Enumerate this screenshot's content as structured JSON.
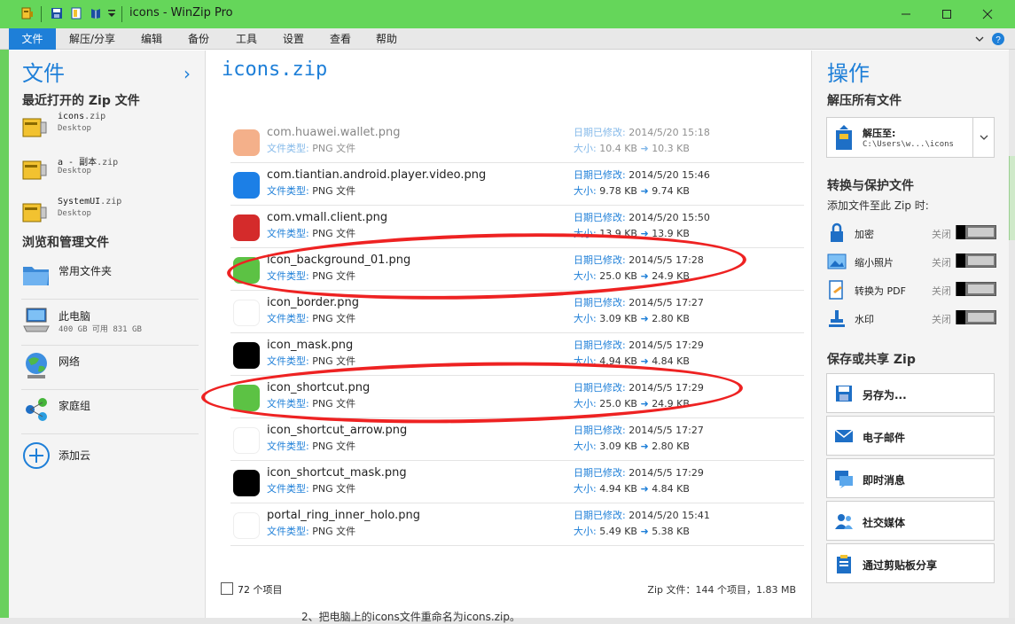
{
  "window": {
    "title": "icons - WinZip Pro",
    "title_bar_color": "#65d65a",
    "accent_color": "#1e7fd8",
    "controls": [
      "minimize-icon",
      "maximize-icon",
      "close-icon"
    ]
  },
  "menu": {
    "items": [
      "文件",
      "解压/分享",
      "编辑",
      "备份",
      "工具",
      "设置",
      "查看",
      "帮助"
    ]
  },
  "left": {
    "title": "文件",
    "recent_heading": "最近打开的 Zip 文件",
    "recent": [
      {
        "name": "icons",
        "ext": ".zip",
        "location": "Desktop"
      },
      {
        "name": "a - 副本",
        "ext": ".zip",
        "location": "Desktop"
      },
      {
        "name": "SystemUI",
        "ext": ".zip",
        "location": "Desktop"
      }
    ],
    "browse_heading": "浏览和管理文件",
    "browse": [
      {
        "label": "常用文件夹",
        "sub": "",
        "icon": "folder-icon"
      },
      {
        "label": "此电脑",
        "sub": "400 GB 可用 831 GB",
        "icon": "computer-icon"
      },
      {
        "label": "网络",
        "sub": "",
        "icon": "network-globe-icon"
      },
      {
        "label": "家庭组",
        "sub": "",
        "icon": "homegroup-icon"
      },
      {
        "label": "添加云",
        "sub": "",
        "icon": "add-cloud-icon"
      }
    ]
  },
  "main": {
    "zip_name": "icons.zip",
    "type_key": "文件类型:",
    "mod_key": "日期已修改:",
    "size_key": "大小:",
    "files": [
      {
        "name": "com.huawei.wallet.png",
        "type": "PNG 文件",
        "modified": "2014/5/20 15:18",
        "size": "10.4 KB",
        "packed": "10.3 KB",
        "thumb": "#f4b08a",
        "faded": true
      },
      {
        "name": "com.tiantian.android.player.video.png",
        "type": "PNG 文件",
        "modified": "2014/5/20 15:46",
        "size": "9.78 KB",
        "packed": "9.74 KB",
        "thumb": "#1c7fe6",
        "faded": false
      },
      {
        "name": "com.vmall.client.png",
        "type": "PNG 文件",
        "modified": "2014/5/20 15:50",
        "size": "13.9 KB",
        "packed": "13.9 KB",
        "thumb": "#d42b2b",
        "faded": false
      },
      {
        "name": "icon_background_01.png",
        "type": "PNG 文件",
        "modified": "2014/5/5 17:28",
        "size": "25.0 KB",
        "packed": "24.9 KB",
        "thumb": "#5cc244",
        "faded": false
      },
      {
        "name": "icon_border.png",
        "type": "PNG 文件",
        "modified": "2014/5/5 17:27",
        "size": "3.09 KB",
        "packed": "2.80 KB",
        "thumb": "#ffffff",
        "faded": false
      },
      {
        "name": "icon_mask.png",
        "type": "PNG 文件",
        "modified": "2014/5/5 17:29",
        "size": "4.94 KB",
        "packed": "4.84 KB",
        "thumb": "#000000",
        "faded": false
      },
      {
        "name": "icon_shortcut.png",
        "type": "PNG 文件",
        "modified": "2014/5/5 17:29",
        "size": "25.0 KB",
        "packed": "24.9 KB",
        "thumb": "#5cc244",
        "faded": false
      },
      {
        "name": "icon_shortcut_arrow.png",
        "type": "PNG 文件",
        "modified": "2014/5/5 17:27",
        "size": "3.09 KB",
        "packed": "2.80 KB",
        "thumb": "#ffffff",
        "faded": false
      },
      {
        "name": "icon_shortcut_mask.png",
        "type": "PNG 文件",
        "modified": "2014/5/5 17:29",
        "size": "4.94 KB",
        "packed": "4.84 KB",
        "thumb": "#000000",
        "faded": false
      },
      {
        "name": "portal_ring_inner_holo.png",
        "type": "PNG 文件",
        "modified": "2014/5/20 15:41",
        "size": "5.49 KB",
        "packed": "5.38 KB",
        "thumb": "#ffffff",
        "faded": false
      }
    ],
    "item_count": "72 个项目",
    "zip_info": "Zip 文件：144 个项目，1.83 MB"
  },
  "right": {
    "title": "操作",
    "unzip_heading": "解压所有文件",
    "unzip_to_label": "解压至:",
    "unzip_to_path": "C:\\Users\\w...\\icons",
    "convert_heading": "转换与保护文件",
    "convert_sub": "添加文件至此 Zip 时:",
    "toggles": [
      {
        "label": "加密",
        "state": "关闭",
        "icon": "lock-icon"
      },
      {
        "label": "缩小照片",
        "state": "关闭",
        "icon": "resize-photo-icon"
      },
      {
        "label": "转换为 PDF",
        "state": "关闭",
        "icon": "pdf-convert-icon"
      },
      {
        "label": "水印",
        "state": "关闭",
        "icon": "watermark-stamp-icon"
      }
    ],
    "share_heading": "保存或共享 Zip",
    "actions": [
      {
        "label": "另存为...",
        "icon": "save-as-icon"
      },
      {
        "label": "电子邮件",
        "icon": "email-icon"
      },
      {
        "label": "即时消息",
        "icon": "instant-message-icon"
      },
      {
        "label": "社交媒体",
        "icon": "social-media-icon"
      },
      {
        "label": "通过剪贴板分享",
        "icon": "clipboard-share-icon"
      }
    ]
  },
  "background": {
    "peek_text": "2、把电脑上的icons文件重命名为icons.zip。"
  }
}
